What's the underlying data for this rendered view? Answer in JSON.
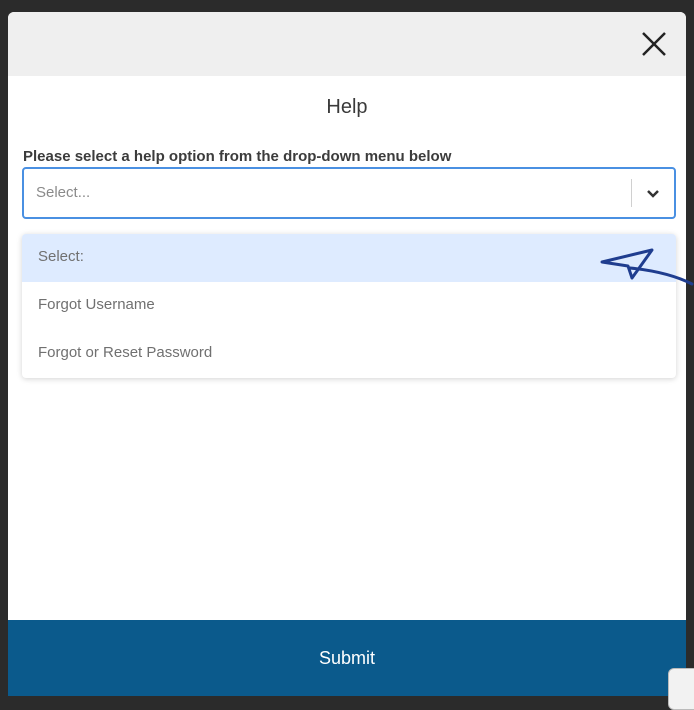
{
  "modal": {
    "title": "Help",
    "prompt": "Please select a help option from the drop-down menu below"
  },
  "select": {
    "value": "Select..."
  },
  "dropdown": {
    "options": [
      {
        "label": "Select:",
        "highlighted": true
      },
      {
        "label": "Forgot Username",
        "highlighted": false
      },
      {
        "label": "Forgot or Reset Password",
        "highlighted": false
      }
    ]
  },
  "submit": {
    "label": "Submit"
  },
  "icons": {
    "close": "close-icon",
    "chevron": "chevron-down-icon",
    "annotation": "hand-drawn-arrow-annotation"
  },
  "colors": {
    "accent": "#4a90e2",
    "submit_bg": "#0b5a8c",
    "highlight": "#deebff"
  }
}
